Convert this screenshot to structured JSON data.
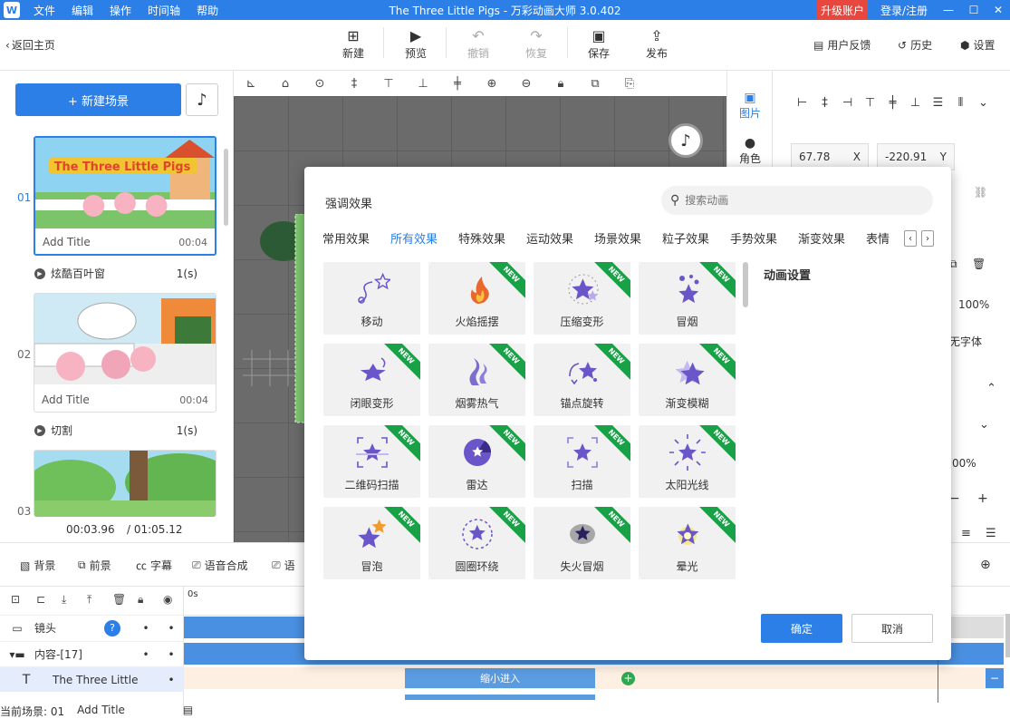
{
  "titlebar": {
    "menu": [
      "文件",
      "编辑",
      "操作",
      "时间轴",
      "帮助"
    ],
    "title": "The Three Little Pigs - 万彩动画大师 3.0.402",
    "upgrade": "升级账户",
    "login": "登录/注册"
  },
  "toolbar": {
    "back": "返回主页",
    "new": "新建",
    "preview": "预览",
    "undo": "撤销",
    "redo": "恢复",
    "save": "保存",
    "publish": "发布",
    "feedback": "用户反馈",
    "history": "历史",
    "settings": "设置"
  },
  "left": {
    "new_scene": "+ 新建场景",
    "scenes": [
      {
        "num": "01",
        "label": "Add Title",
        "duration": "00:04",
        "title_text": "The Three Little Pigs"
      },
      {
        "num": "02",
        "label": "Add Title",
        "duration": "00:04"
      },
      {
        "num": "03"
      }
    ],
    "transitions": [
      {
        "name": "炫酷百叶窗",
        "dur": "1(s)"
      },
      {
        "name": "切割",
        "dur": "1(s)"
      }
    ],
    "time_current": "00:03.96",
    "time_total": "/ 01:05.12"
  },
  "rstrip": {
    "image": "图片",
    "role": "角色"
  },
  "rpanel": {
    "x_val": "67.78",
    "x_label": "X",
    "y_val": "-220.91",
    "y_label": "Y",
    "pct1": "100%",
    "font_partial": "无字体",
    "pct2": "00%"
  },
  "bottombar": {
    "bg": "背景",
    "fg": "前景",
    "subtitle": "字幕",
    "tts": "语音合成",
    "partial": "语"
  },
  "timeline": {
    "zero": "0s",
    "camera": "镜头",
    "content": "内容-[17]",
    "text_layer": "The Three Little",
    "bar_label": "缩小进入",
    "status_scene": "当前场景: 01",
    "status_title": "Add Title"
  },
  "dialog": {
    "title": "强调效果",
    "search_placeholder": "搜索动画",
    "tabs": [
      "常用效果",
      "所有效果",
      "特殊效果",
      "运动效果",
      "场景效果",
      "粒子效果",
      "手势效果",
      "渐变效果",
      "表情"
    ],
    "active_tab": "所有效果",
    "effects": [
      {
        "name": "移动",
        "new": false,
        "icon": "move-star-icon"
      },
      {
        "name": "火焰摇摆",
        "new": true,
        "icon": "flame-icon"
      },
      {
        "name": "压缩变形",
        "new": true,
        "icon": "compress-star-icon"
      },
      {
        "name": "冒烟",
        "new": true,
        "icon": "smoke-star-icon"
      },
      {
        "name": "闭眼变形",
        "new": true,
        "icon": "blink-star-icon"
      },
      {
        "name": "烟雾热气",
        "new": true,
        "icon": "steam-icon"
      },
      {
        "name": "锚点旋转",
        "new": true,
        "icon": "anchor-rotate-icon"
      },
      {
        "name": "渐变模糊",
        "new": true,
        "icon": "blur-star-icon"
      },
      {
        "name": "二维码扫描",
        "new": true,
        "icon": "qr-scan-icon"
      },
      {
        "name": "雷达",
        "new": true,
        "icon": "radar-icon"
      },
      {
        "name": "扫描",
        "new": true,
        "icon": "scan-star-icon"
      },
      {
        "name": "太阳光线",
        "new": true,
        "icon": "sun-ray-icon"
      },
      {
        "name": "冒泡",
        "new": true,
        "icon": "bubble-star-icon"
      },
      {
        "name": "圆圈环绕",
        "new": true,
        "icon": "circle-orbit-icon"
      },
      {
        "name": "失火冒烟",
        "new": true,
        "icon": "fire-smoke-icon"
      },
      {
        "name": "晕光",
        "new": true,
        "icon": "halo-star-icon"
      }
    ],
    "new_badge": "NEW",
    "settings_title": "动画设置",
    "ok": "确定",
    "cancel": "取消"
  },
  "colors": {
    "accent": "#2c7fe6",
    "star": "#6a55c9",
    "new_badge": "#18a146"
  }
}
